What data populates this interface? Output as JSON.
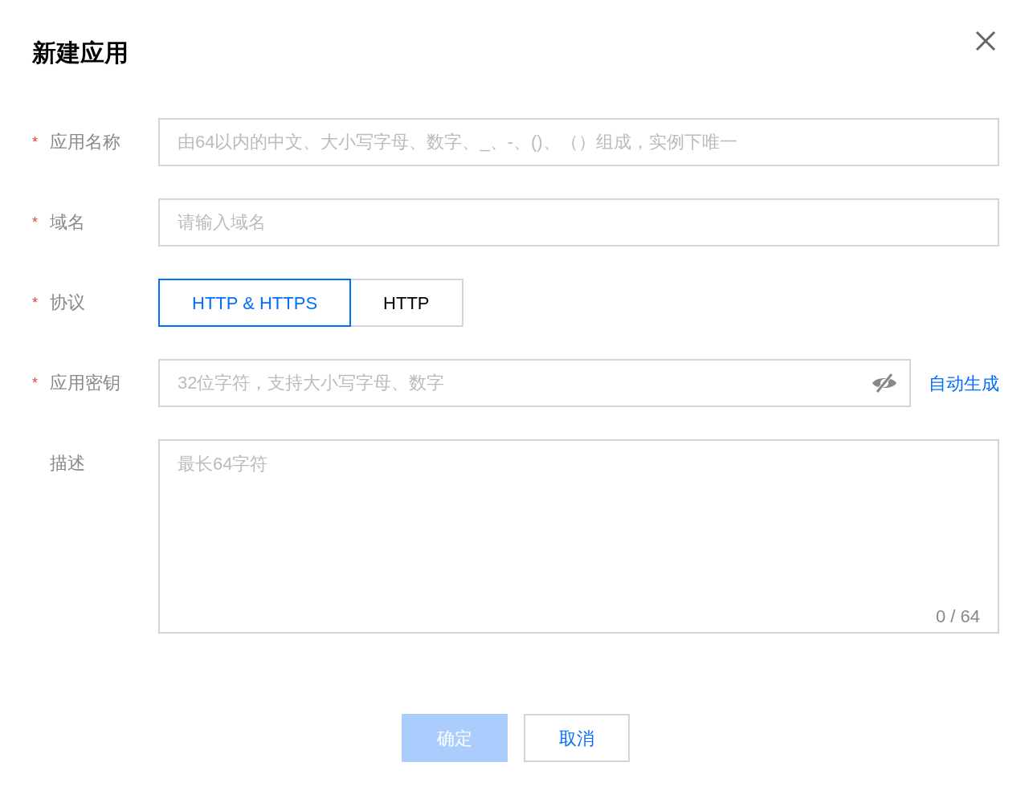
{
  "dialog": {
    "title": "新建应用"
  },
  "fields": [
    {
      "kind": "input",
      "label": "应用名称",
      "required_mark": "*",
      "placeholder": "由64以内的中文、大小写字母、数字、_、-、()、（）组成，实例下唯一"
    },
    {
      "kind": "input",
      "label": "域名",
      "required_mark": "*",
      "placeholder": "请输入域名"
    },
    {
      "kind": "segmented",
      "label": "协议",
      "required_mark": "*",
      "options": [
        {
          "label": "HTTP & HTTPS",
          "selected": true
        },
        {
          "label": "HTTP",
          "selected": false
        }
      ]
    },
    {
      "kind": "secret",
      "label": "应用密钥",
      "required_mark": "*",
      "placeholder": "32位字符，支持大小写字母、数字",
      "action": "自动生成"
    },
    {
      "kind": "textarea",
      "label": "描述",
      "placeholder": "最长64字符",
      "counter": "0 / 64"
    }
  ],
  "buttons": [
    {
      "label": "确定",
      "kind": "primary",
      "disabled": true
    },
    {
      "label": "取消",
      "kind": "secondary"
    }
  ]
}
